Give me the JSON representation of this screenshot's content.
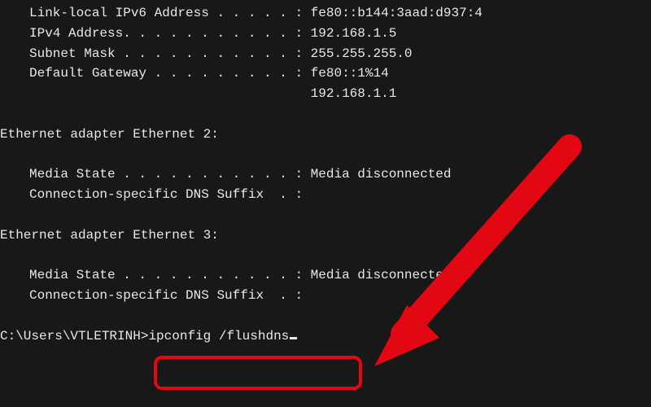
{
  "netinfo": {
    "rows": [
      {
        "label": "Link-local IPv6 Address . . . . . :",
        "value": "fe80::b144:3aad:d937:4"
      },
      {
        "label": "IPv4 Address. . . . . . . . . . . :",
        "value": "192.168.1.5"
      },
      {
        "label": "Subnet Mask . . . . . . . . . . . :",
        "value": "255.255.255.0"
      },
      {
        "label": "Default Gateway . . . . . . . . . :",
        "value": "fe80::1%14"
      },
      {
        "label": "                                   ",
        "value": "192.168.1.1"
      }
    ]
  },
  "adapters": [
    {
      "heading": "Ethernet adapter Ethernet 2:",
      "rows": [
        {
          "label": "Media State . . . . . . . . . . . :",
          "value": "Media disconnected"
        },
        {
          "label": "Connection-specific DNS Suffix  . :",
          "value": ""
        }
      ]
    },
    {
      "heading": "Ethernet adapter Ethernet 3:",
      "rows": [
        {
          "label": "Media State . . . . . . . . . . . :",
          "value": "Media disconnected"
        },
        {
          "label": "Connection-specific DNS Suffix  . :",
          "value": ""
        }
      ]
    }
  ],
  "prompt": {
    "path": "C:\\Users\\VTLETRINH>",
    "command": "ipconfig /flushdns"
  },
  "annotation": {
    "arrow_color": "#e30613",
    "box_color": "#e30613"
  }
}
